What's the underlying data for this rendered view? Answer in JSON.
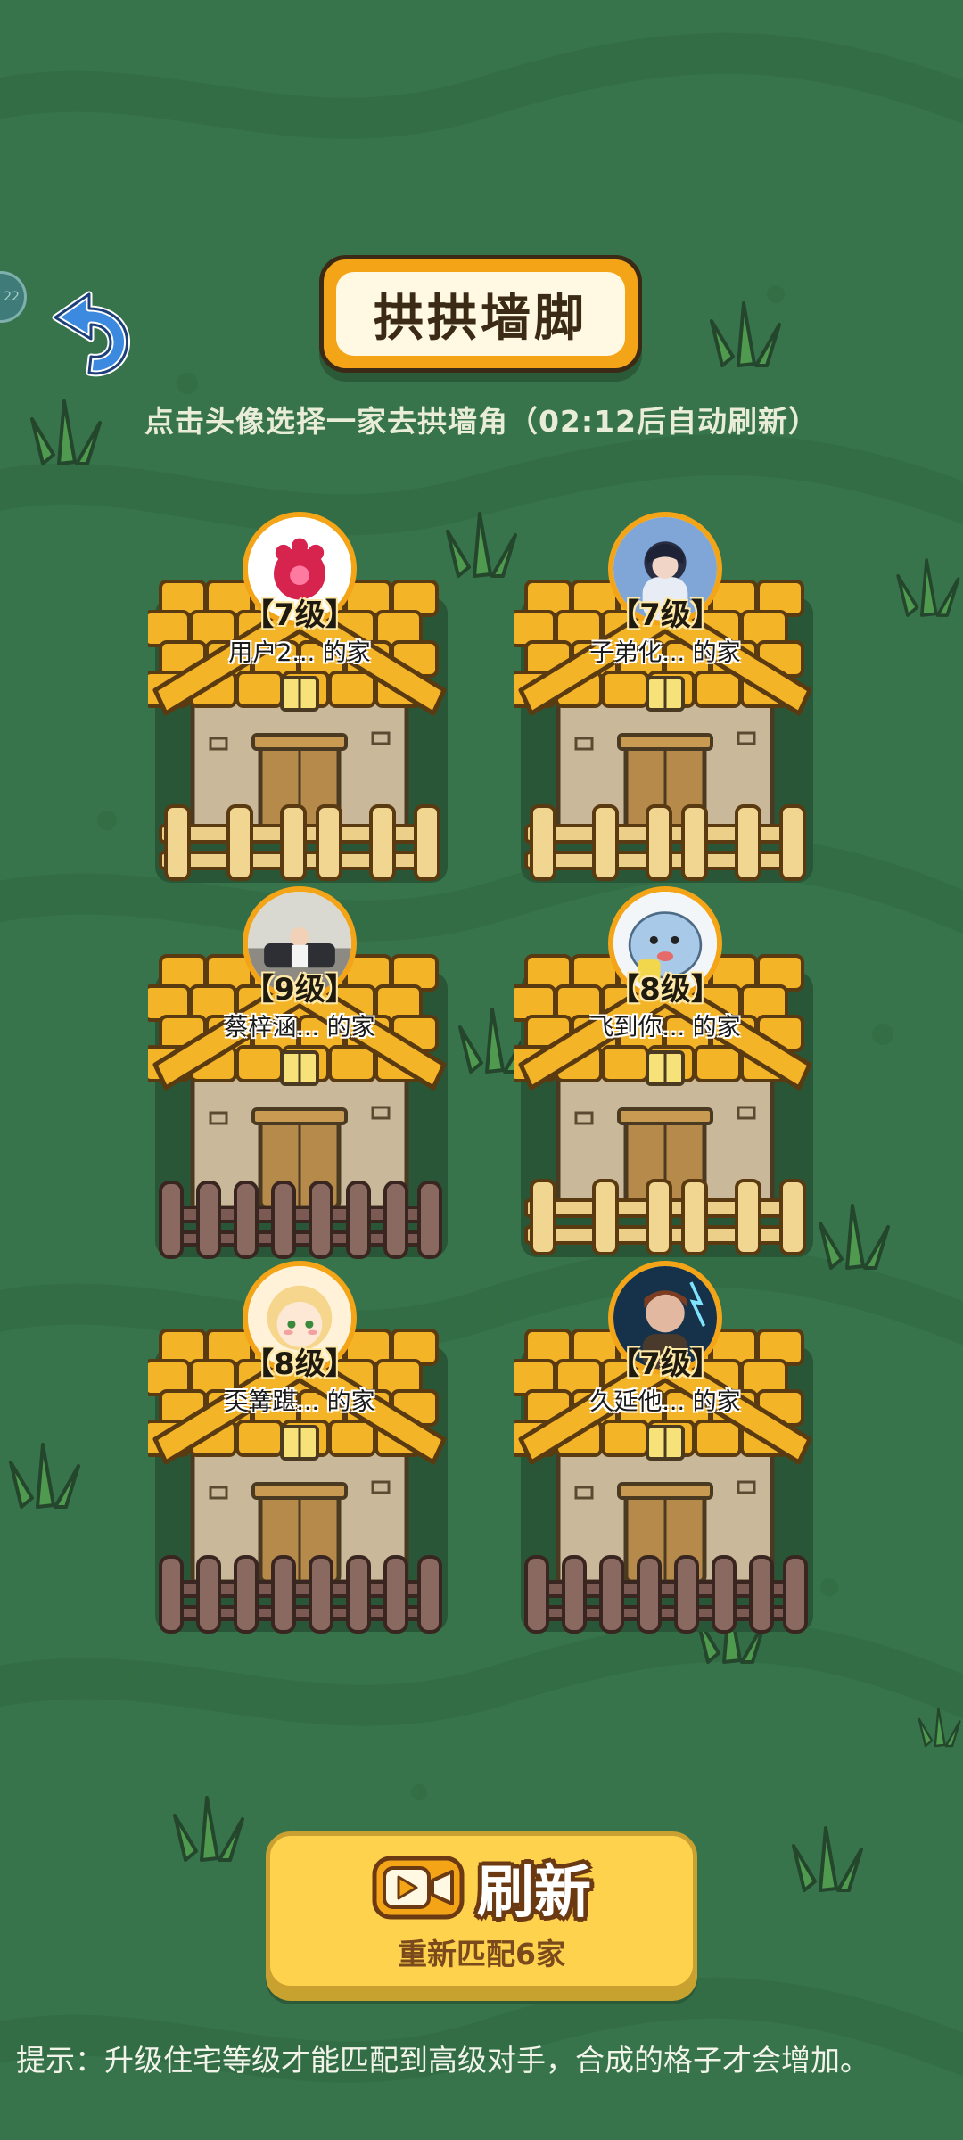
{
  "title": "拱拱墙脚",
  "subtitle": "点击头像选择一家去拱墙角（02:12后自动刷新）",
  "side_badge": "22",
  "houses": [
    {
      "level": "【7级】",
      "name": "用户2... 的家",
      "fence": "wood"
    },
    {
      "level": "【7级】",
      "name": "子弟化... 的家",
      "fence": "wood"
    },
    {
      "level": "【9级】",
      "name": "蔡梓涵... 的家",
      "fence": "stone"
    },
    {
      "level": "【8级】",
      "name": "飞到你... 的家",
      "fence": "wood"
    },
    {
      "level": "【8级】",
      "name": "奀篝踸... 的家",
      "fence": "stone"
    },
    {
      "level": "【7级】",
      "name": "久延他... 的家",
      "fence": "stone"
    }
  ],
  "refresh": {
    "label": "刷新",
    "sub_label": "重新匹配6家",
    "icon": "video-icon"
  },
  "tip": "提示：升级住宅等级才能匹配到高级对手，合成的格子才会增加。",
  "icons": {
    "back": "undo-arrow-icon",
    "grass": "grass-tuft-icon"
  },
  "colors": {
    "background": "#37744b",
    "roof": "#f4b428",
    "title_border": "#f4a417",
    "button": "#ffd24d"
  }
}
